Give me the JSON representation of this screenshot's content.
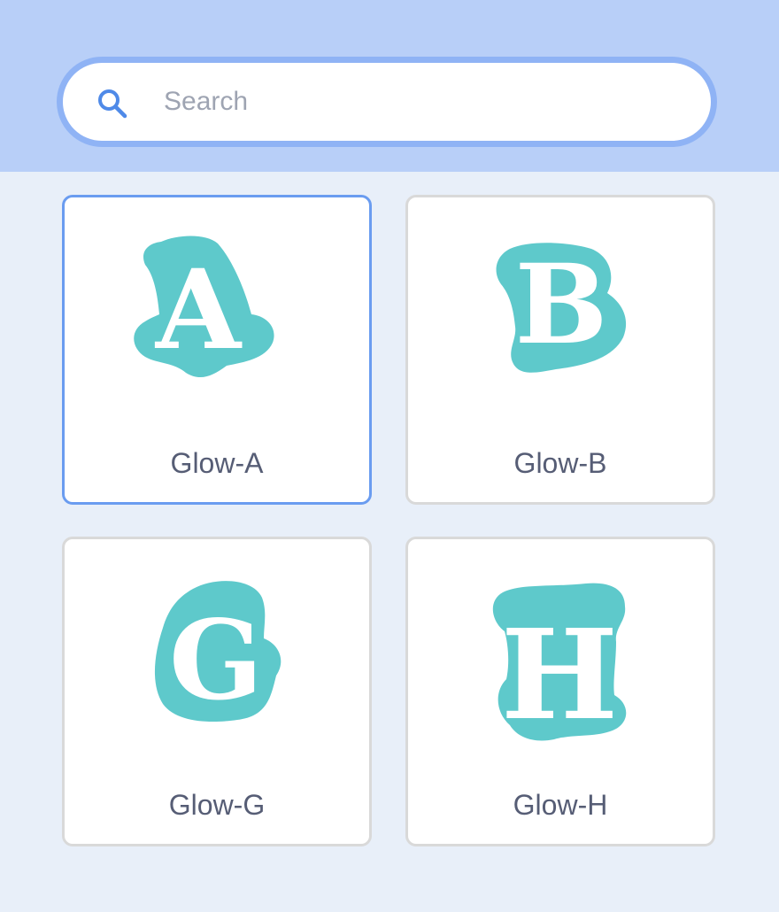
{
  "search": {
    "placeholder": "Search",
    "value": "",
    "icon": "search-icon"
  },
  "colors": {
    "header_band": "#b8cff8",
    "search_border": "#8fb3f5",
    "page_background": "#e8eff9",
    "glyph_fill": "#5ec9cb",
    "selected_border": "#6a9cf0",
    "label_text": "#565d75"
  },
  "items": [
    {
      "glyph": "A",
      "label": "Glow-A",
      "selected": true
    },
    {
      "glyph": "B",
      "label": "Glow-B",
      "selected": false
    },
    {
      "glyph": "G",
      "label": "Glow-G",
      "selected": false
    },
    {
      "glyph": "H",
      "label": "Glow-H",
      "selected": false
    }
  ]
}
